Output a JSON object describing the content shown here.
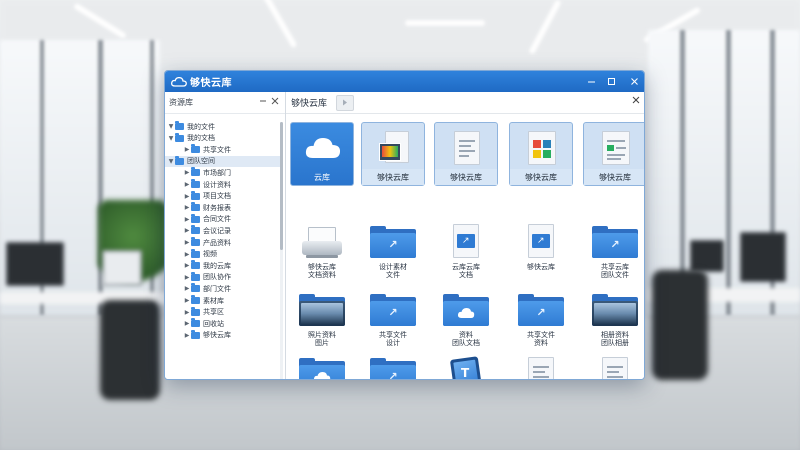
{
  "window": {
    "title": "够快云库",
    "accent": "#1f6ac4"
  },
  "tree": {
    "header": "资源库",
    "items": [
      {
        "label": "我的文件",
        "level": 1,
        "expanded": true
      },
      {
        "label": "我的文档",
        "level": 1,
        "expanded": true
      },
      {
        "label": "共享文件",
        "level": 2
      },
      {
        "label": "团队空间",
        "level": 1,
        "expanded": true,
        "selected": true
      },
      {
        "label": "市场部门",
        "level": 2
      },
      {
        "label": "设计资料",
        "level": 2
      },
      {
        "label": "项目文档",
        "level": 2
      },
      {
        "label": "财务报表",
        "level": 2
      },
      {
        "label": "合同文件",
        "level": 2
      },
      {
        "label": "会议记录",
        "level": 2
      },
      {
        "label": "产品资料",
        "level": 2
      },
      {
        "label": "视频",
        "level": 2
      },
      {
        "label": "我的云库",
        "level": 2
      },
      {
        "label": "团队协作",
        "level": 2
      },
      {
        "label": "部门文件",
        "level": 2
      },
      {
        "label": "素材库",
        "level": 2
      },
      {
        "label": "共享区",
        "level": 2
      },
      {
        "label": "回收站",
        "level": 2
      },
      {
        "label": "够快云库",
        "level": 2
      }
    ]
  },
  "tabs": {
    "active": "够快云库"
  },
  "featured": [
    {
      "label": "云库",
      "icon": "cloud-icon"
    },
    {
      "label": "够快云库",
      "icon": "document-stack-icon"
    },
    {
      "label": "够快云库",
      "icon": "document-icon"
    },
    {
      "label": "够快云库",
      "icon": "spreadsheet-icon"
    },
    {
      "label": "够快云库",
      "icon": "report-icon"
    }
  ],
  "row2": [
    {
      "label": "够快云库\n文档资料",
      "icon": "scanner-icon"
    },
    {
      "label": "设计素材\n文件",
      "icon": "folder-share-icon"
    },
    {
      "label": "云库云库\n文档",
      "icon": "doc-folder-icon"
    },
    {
      "label": "够快云库",
      "icon": "doc-folder-icon"
    },
    {
      "label": "共享云库\n团队文件",
      "icon": "folder-share-icon"
    }
  ],
  "row3": [
    {
      "label": "照片资料\n图片",
      "icon": "photo-folder-icon"
    },
    {
      "label": "共享文件\n设计",
      "icon": "folder-share-icon"
    },
    {
      "label": "资料\n团队文档",
      "icon": "cloud-folder-icon"
    },
    {
      "label": "共享文件\n资料",
      "icon": "folder-share-icon"
    },
    {
      "label": "相册资料\n团队相册",
      "icon": "photo-folder-icon"
    }
  ],
  "row4": [
    {
      "label": "",
      "icon": "cloud-folder-icon"
    },
    {
      "label": "",
      "icon": "folder-share-icon"
    },
    {
      "label": "",
      "icon": "tablet-icon"
    },
    {
      "label": "",
      "icon": "document-icon"
    },
    {
      "label": "",
      "icon": "document-icon"
    }
  ]
}
